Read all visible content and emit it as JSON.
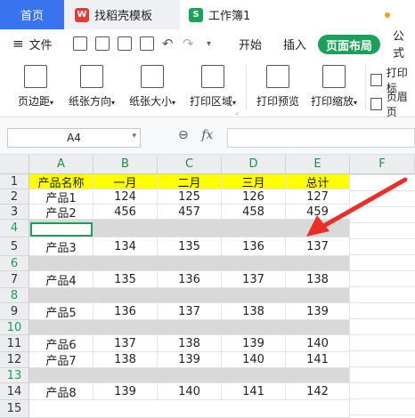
{
  "tabs": {
    "home": "首页",
    "template": "找稻壳模板",
    "template_icon": "W",
    "workbook": "工作簿1",
    "workbook_icon": "S"
  },
  "menu": {
    "file": "文件",
    "start": "开始",
    "insert": "插入",
    "page_layout": "页面布局",
    "formula": "公式"
  },
  "ribbon": {
    "margins": "页边距",
    "orientation": "纸张方向",
    "size": "纸张大小",
    "print_area": "打印区域",
    "print_preview": "打印预览",
    "print_scale": "打印缩放",
    "print_title": "打印标",
    "header_footer": "页眉页"
  },
  "formula_bar": {
    "name_box": "A4",
    "fx": "fx"
  },
  "columns": [
    "A",
    "B",
    "C",
    "D",
    "E",
    "F"
  ],
  "rows": [
    "1",
    "2",
    "3",
    "4",
    "5",
    "6",
    "7",
    "8",
    "9",
    "10",
    "11",
    "12",
    "13",
    "14",
    "15"
  ],
  "cells": {
    "r1": [
      "产品名称",
      "一月",
      "二月",
      "三月",
      "总计"
    ],
    "r2": [
      "产品1",
      "124",
      "125",
      "126",
      "127"
    ],
    "r3": [
      "产品2",
      "456",
      "457",
      "458",
      "459"
    ],
    "r5": [
      "产品3",
      "134",
      "135",
      "136",
      "137"
    ],
    "r7": [
      "产品4",
      "135",
      "136",
      "137",
      "138"
    ],
    "r9": [
      "产品5",
      "136",
      "137",
      "138",
      "139"
    ],
    "r11": [
      "产品6",
      "137",
      "138",
      "139",
      "140"
    ],
    "r12": [
      "产品7",
      "138",
      "139",
      "140",
      "141"
    ],
    "r14": [
      "产品8",
      "139",
      "140",
      "141",
      "142"
    ]
  },
  "colors": {
    "accent": "#1aa05a",
    "header_fill": "#ffff00",
    "blank_row_fill": "#d9d9d9",
    "arrow": "#e8302a"
  }
}
